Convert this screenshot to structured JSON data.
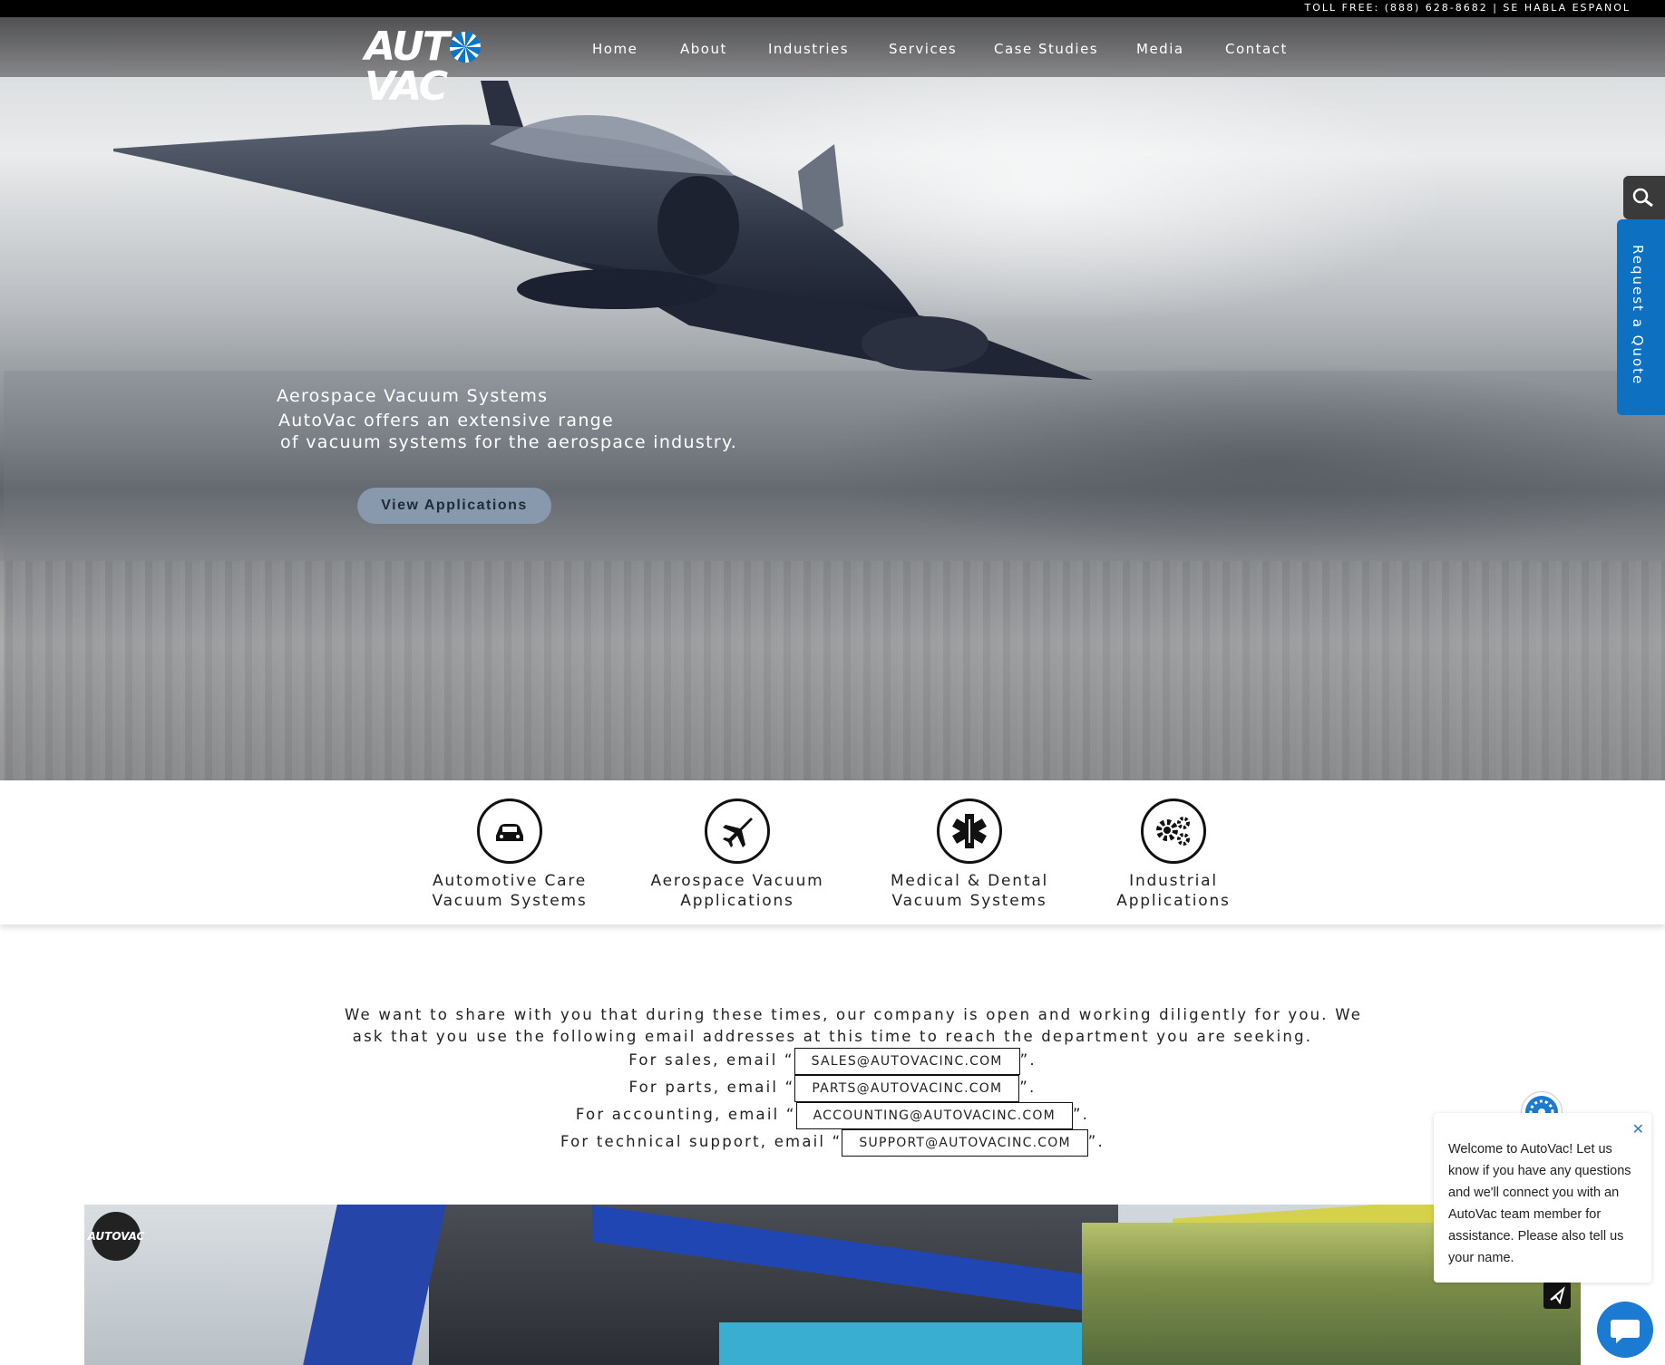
{
  "topbar": {
    "phone_line": "TOLL FREE: (888) 628-8682 | SE HABLA ESPANOL"
  },
  "brand": {
    "logo_left": "AUT",
    "logo_right": "VAC"
  },
  "nav": [
    "Home",
    "About",
    "Industries",
    "Services",
    "Case Studies",
    "Media",
    "Contact"
  ],
  "hero": {
    "title": "Aerospace Vacuum Systems",
    "line1": "AutoVac offers an extensive range",
    "line2": "of vacuum systems for the aerospace industry.",
    "button": "View Applications"
  },
  "side_tabs": {
    "search_icon": "search-icon",
    "quote": "Request a Quote"
  },
  "industries": [
    {
      "icon": "car-icon",
      "line1": "Automotive Care",
      "line2": "Vacuum Systems"
    },
    {
      "icon": "jet-icon",
      "line1": "Aerospace Vacuum",
      "line2": "Applications"
    },
    {
      "icon": "medical-icon",
      "line1": "Medical & Dental",
      "line2": "Vacuum Systems"
    },
    {
      "icon": "gears-icon",
      "line1": "Industrial",
      "line2": "Applications"
    }
  ],
  "notice": {
    "line1": "We want to share with you that during these times, our company is open and working diligently for you. We",
    "line2": "ask that you use the following email addresses at this time to reach the department you are seeking.",
    "sales_prefix": "For sales, email “",
    "sales_email": "SALES@AUTOVACINC.COM",
    "parts_prefix": "For parts, email “",
    "parts_email": "PARTS@AUTOVACINC.COM",
    "accounting_prefix": "For accounting, email “",
    "accounting_email": "ACCOUNTING@AUTOVACINC.COM",
    "support_prefix": "For technical support, email “",
    "support_email": "SUPPORT@AUTOVACINC.COM",
    "close_quote": "”."
  },
  "video": {
    "logo_text": "AUTOVAC"
  },
  "chat": {
    "message": "Welcome to AutoVac! Let us know if you have any questions and we'll connect you with an AutoVac team member for assistance. Please also tell us your name.",
    "close": "✕"
  },
  "colors": {
    "accent_blue": "#0e70c0",
    "button_bg": "#8898ad"
  }
}
